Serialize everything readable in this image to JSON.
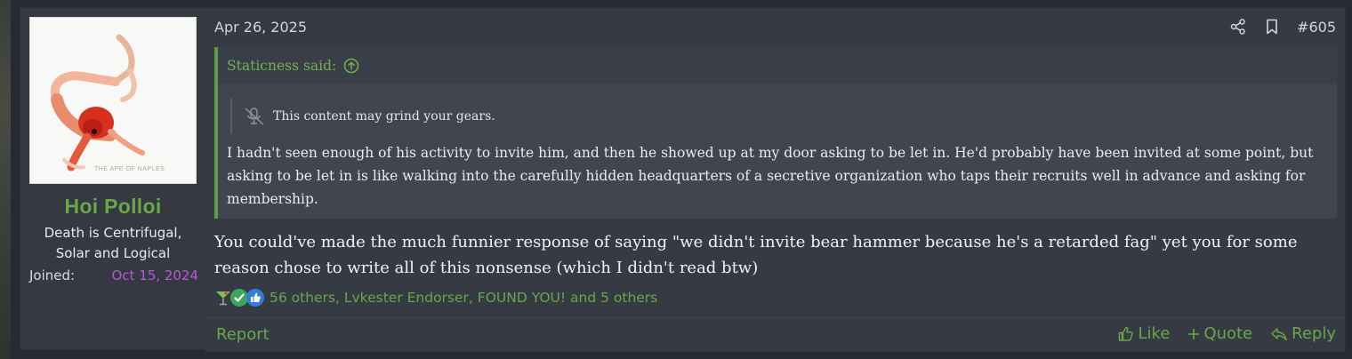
{
  "user": {
    "name": "Hoi Polloi",
    "title": "Death is Centrifugal, Solar and Logical",
    "joined_label": "Joined:",
    "joined_date": "Oct 15, 2024",
    "avatar_caption": "THE APE OF NAPLES"
  },
  "post": {
    "date": "Apr 26, 2025",
    "number": "#605",
    "quote": {
      "author": "Staticness said:",
      "spoiler_label": "This content may grind your gears.",
      "text": "I hadn't seen enough of his activity to invite him, and then he showed up at my door asking to be let in. He'd probably have been invited at some point, but asking to be let in is like walking into the carefully hidden headquarters of a secretive organization who taps their recruits well in advance and asking for membership."
    },
    "message": "You could've made the much funnier response of saying \"we didn't invite bear hammer because he's a retarded fag\" yet you for some reason chose to write all of this nonsense (which I didn't read btw)",
    "reactions": {
      "icons": [
        "cocktail-icon",
        "check-icon",
        "thumbs-up-icon"
      ],
      "summary": "56 others, Lvkester Endorser, FOUND YOU! and 5 others"
    }
  },
  "footer": {
    "report": "Report",
    "like": "Like",
    "quote": "Quote",
    "reply": "Reply"
  },
  "colors": {
    "accent_green": "#6aa64a",
    "joined_date": "#b45ad6",
    "post_bg": "#363a43",
    "quote_bg": "#404550"
  }
}
